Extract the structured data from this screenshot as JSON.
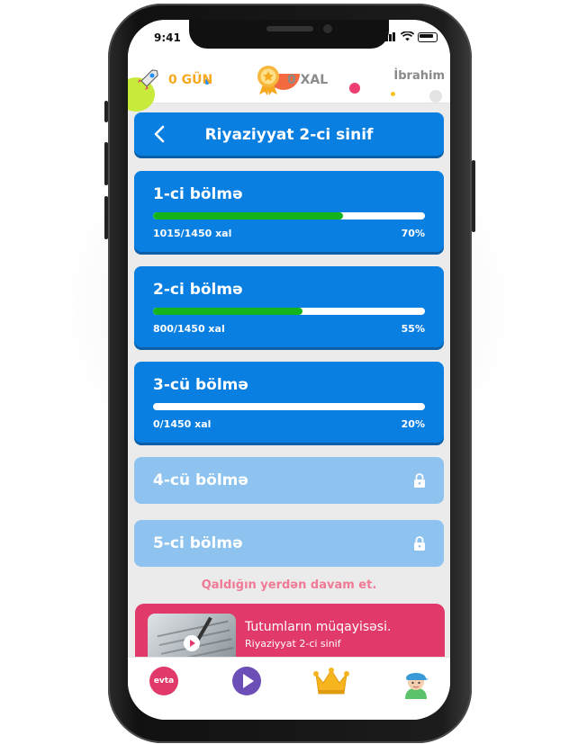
{
  "status_bar": {
    "time": "9:41"
  },
  "header": {
    "streak": "0 GÜN",
    "points": "0 XAL",
    "username": "İbrahim"
  },
  "topbar": {
    "title": "Riyaziyyat 2-ci sinif"
  },
  "sections": [
    {
      "title": "1-ci bölmə",
      "score": "1015/1450 xal",
      "percent": "70%",
      "progress": 0.7,
      "locked": false
    },
    {
      "title": "2-ci bölmə",
      "score": "800/1450 xal",
      "percent": "55%",
      "progress": 0.55,
      "locked": false
    },
    {
      "title": "3-cü bölmə",
      "score": "0/1450 xal",
      "percent": "20%",
      "progress": 0.0,
      "locked": false
    },
    {
      "title": "4-cü bölmə",
      "locked": true
    },
    {
      "title": "5-ci bölmə",
      "locked": true
    }
  ],
  "continue_text": "Qaldığın yerdən davam et.",
  "resume_card": {
    "title": "Tutumların müqayisəsi.",
    "subtitle": "Riyaziyyat 2-ci sinif"
  },
  "tabbar": {
    "items": [
      {
        "label": "evta",
        "icon": "evta-logo-icon"
      },
      {
        "icon": "play-icon"
      },
      {
        "icon": "crown-icon"
      },
      {
        "icon": "avatar-icon"
      }
    ]
  },
  "colors": {
    "primary": "#0a7fe2",
    "locked": "#8ec3ef",
    "progress": "#14b51c",
    "accent": "#e0396a",
    "streak": "#f6a91f"
  }
}
